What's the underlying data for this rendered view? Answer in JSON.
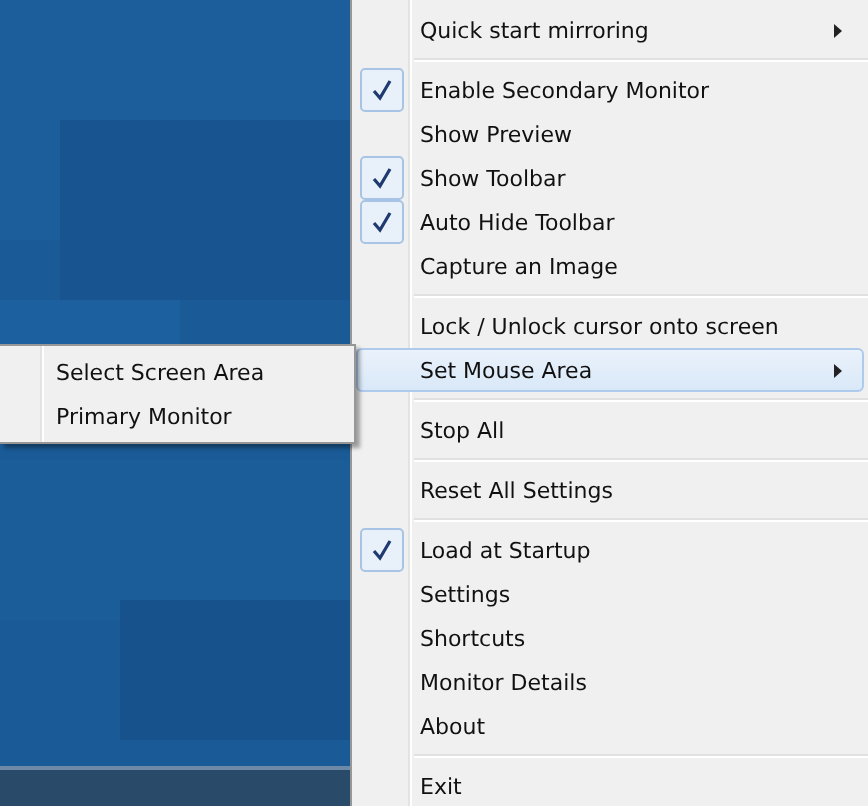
{
  "context_menu": {
    "items": [
      {
        "kind": "item",
        "label": "Quick start mirroring",
        "checked": false,
        "selected": false,
        "has_submenu": true
      },
      {
        "kind": "separator"
      },
      {
        "kind": "item",
        "label": "Enable Secondary Monitor",
        "checked": true,
        "selected": false,
        "has_submenu": false
      },
      {
        "kind": "item",
        "label": "Show Preview",
        "checked": false,
        "selected": false,
        "has_submenu": false
      },
      {
        "kind": "item",
        "label": "Show Toolbar",
        "checked": true,
        "selected": false,
        "has_submenu": false
      },
      {
        "kind": "item",
        "label": "Auto Hide Toolbar",
        "checked": true,
        "selected": false,
        "has_submenu": false
      },
      {
        "kind": "item",
        "label": "Capture an Image",
        "checked": false,
        "selected": false,
        "has_submenu": false
      },
      {
        "kind": "separator"
      },
      {
        "kind": "item",
        "label": "Lock / Unlock cursor onto screen",
        "checked": false,
        "selected": false,
        "has_submenu": false
      },
      {
        "kind": "item",
        "label": "Set Mouse Area",
        "checked": false,
        "selected": true,
        "has_submenu": true
      },
      {
        "kind": "separator"
      },
      {
        "kind": "item",
        "label": "Stop All",
        "checked": false,
        "selected": false,
        "has_submenu": false
      },
      {
        "kind": "separator"
      },
      {
        "kind": "item",
        "label": "Reset All Settings",
        "checked": false,
        "selected": false,
        "has_submenu": false
      },
      {
        "kind": "separator"
      },
      {
        "kind": "item",
        "label": "Load at Startup",
        "checked": true,
        "selected": false,
        "has_submenu": false
      },
      {
        "kind": "item",
        "label": "Settings",
        "checked": false,
        "selected": false,
        "has_submenu": false
      },
      {
        "kind": "item",
        "label": "Shortcuts",
        "checked": false,
        "selected": false,
        "has_submenu": false
      },
      {
        "kind": "item",
        "label": "Monitor Details",
        "checked": false,
        "selected": false,
        "has_submenu": false
      },
      {
        "kind": "item",
        "label": "About",
        "checked": false,
        "selected": false,
        "has_submenu": false
      },
      {
        "kind": "separator"
      },
      {
        "kind": "item",
        "label": "Exit",
        "checked": false,
        "selected": false,
        "has_submenu": false
      }
    ]
  },
  "submenu": {
    "items": [
      {
        "label": "Select Screen Area",
        "selected": false
      },
      {
        "label": "Primary Monitor",
        "selected": false
      }
    ]
  }
}
